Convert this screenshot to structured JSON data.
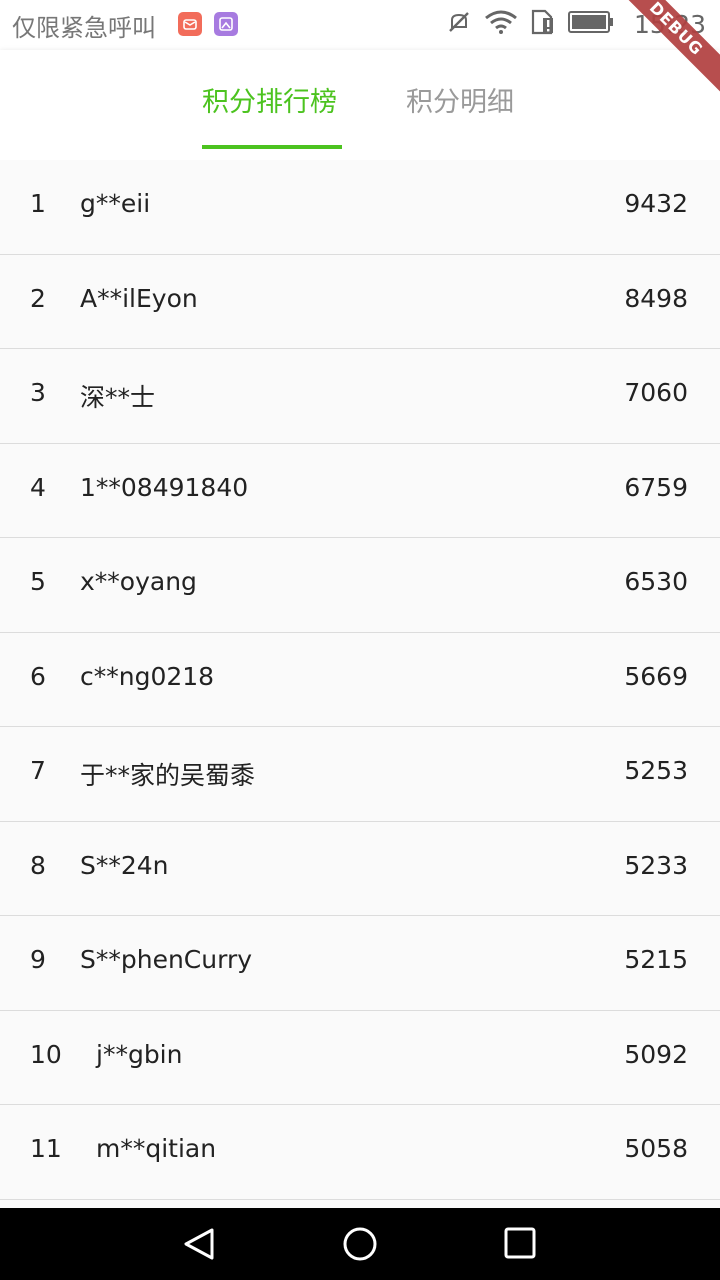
{
  "status_bar": {
    "carrier": "仅限紧急呼叫",
    "time": "15:23",
    "icons": [
      "mail-icon",
      "image-icon",
      "mute-icon",
      "wifi-icon",
      "sim-alert-icon",
      "battery-icon"
    ]
  },
  "debug_banner": "DEBUG",
  "tabs": [
    {
      "label": "积分排行榜",
      "active": true
    },
    {
      "label": "积分明细",
      "active": false
    }
  ],
  "colors": {
    "accent": "#4cc31f",
    "inactive_tab": "#9a9a9a"
  },
  "rows": [
    {
      "rank": "1",
      "name": "g**eii",
      "score": "9432"
    },
    {
      "rank": "2",
      "name": "A**ilEyon",
      "score": "8498"
    },
    {
      "rank": "3",
      "name": "深**士",
      "score": "7060"
    },
    {
      "rank": "4",
      "name": "1**08491840",
      "score": "6759"
    },
    {
      "rank": "5",
      "name": "x**oyang",
      "score": "6530"
    },
    {
      "rank": "6",
      "name": "c**ng0218",
      "score": "5669"
    },
    {
      "rank": "7",
      "name": "于**家的吴蜀黍",
      "score": "5253"
    },
    {
      "rank": "8",
      "name": "S**24n",
      "score": "5233"
    },
    {
      "rank": "9",
      "name": "S**phenCurry",
      "score": "5215"
    },
    {
      "rank": "10",
      "name": "j**gbin",
      "score": "5092"
    },
    {
      "rank": "11",
      "name": "m**qitian",
      "score": "5058"
    }
  ],
  "nav": [
    "back-icon",
    "home-icon",
    "recents-icon"
  ]
}
